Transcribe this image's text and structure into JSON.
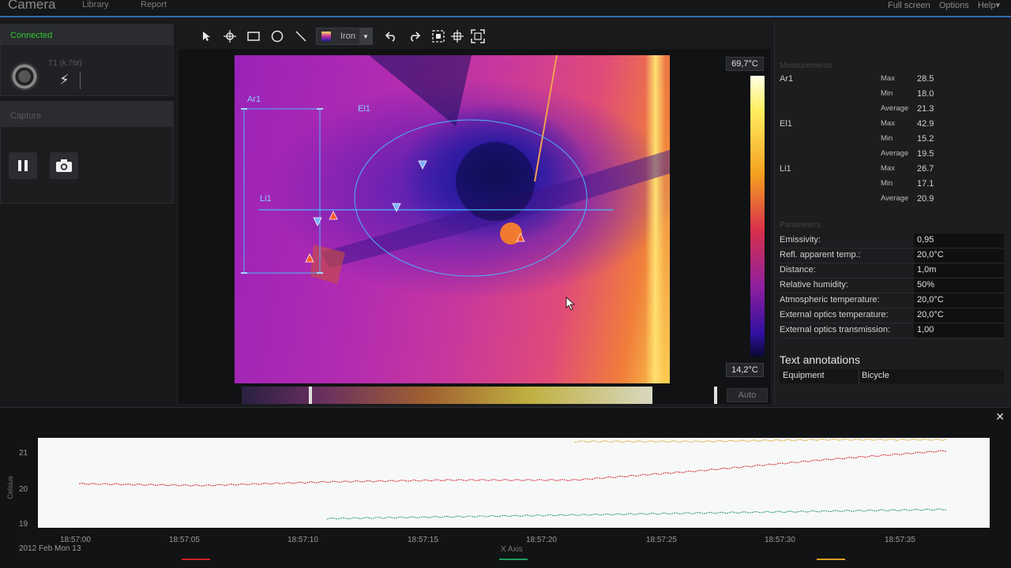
{
  "topbar": {
    "title": "Camera",
    "menu": [
      "Library",
      "Report"
    ],
    "right": [
      "Full screen",
      "Options",
      "Help▾"
    ]
  },
  "left": {
    "status": "Connected",
    "camera_name": "T1 (k.7bt)",
    "capture_header": "Capture"
  },
  "toolbar": {
    "palette": "Iron"
  },
  "image": {
    "temp_max": "69,7°C",
    "temp_min": "14,2°C",
    "auto_label": "Auto",
    "labels": {
      "ar1": "Ar1",
      "el1": "El1",
      "li1": "Li1"
    }
  },
  "measurements": {
    "header": "Measurements",
    "rows": [
      {
        "name": "Ar1",
        "stat": "Max",
        "value": "28.5"
      },
      {
        "name": "",
        "stat": "Min",
        "value": "18.0"
      },
      {
        "name": "",
        "stat": "Average",
        "value": "21.3"
      },
      {
        "name": "El1",
        "stat": "Max",
        "value": "42.9"
      },
      {
        "name": "",
        "stat": "Min",
        "value": "15.2"
      },
      {
        "name": "",
        "stat": "Average",
        "value": "19.5"
      },
      {
        "name": "Li1",
        "stat": "Max",
        "value": "26.7"
      },
      {
        "name": "",
        "stat": "Min",
        "value": "17.1"
      },
      {
        "name": "",
        "stat": "Average",
        "value": "20.9"
      }
    ]
  },
  "parameters": {
    "header": "Parameters",
    "rows": [
      {
        "label": "Emissivity:",
        "value": "0,95"
      },
      {
        "label": "Refl. apparent temp.:",
        "value": "20,0°C"
      },
      {
        "label": "Distance:",
        "value": "1,0m"
      },
      {
        "label": "Relative humidity:",
        "value": "50%"
      },
      {
        "label": "Atmospheric temperature:",
        "value": "20,0°C"
      },
      {
        "label": "External optics temperature:",
        "value": "20,0°C"
      },
      {
        "label": "External optics transmission:",
        "value": "1,00"
      }
    ]
  },
  "annotations": {
    "title": "Text annotations",
    "key": "Equipment",
    "value": "Bicycle"
  },
  "plot": {
    "ylabel": "Celsius",
    "yticks": [
      "21",
      "20",
      "19"
    ],
    "xticks": [
      "18:57:00",
      "18:57:05",
      "18:57:10",
      "18:57:15",
      "18:57:20",
      "18:57:25",
      "18:57:30",
      "18:57:35"
    ],
    "xlabel": "X Axis",
    "date": "2012 Feb Mon 13",
    "series_colors": [
      "#d0202a",
      "#1c9a5a",
      "#d8a020"
    ]
  },
  "chart_data": {
    "type": "line",
    "xlabel": "X Axis",
    "ylabel": "Celsius",
    "ylim": [
      18.85,
      21.3
    ],
    "x": [
      "18:57:00",
      "18:57:05",
      "18:57:10",
      "18:57:15",
      "18:57:20",
      "18:57:25",
      "18:57:30",
      "18:57:35"
    ],
    "series": [
      {
        "color": "#d0202a",
        "values": [
          20.05,
          20.0,
          20.1,
          20.15,
          20.15,
          20.4,
          20.7,
          20.95
        ]
      },
      {
        "color": "#1c9a5a",
        "values": [
          null,
          null,
          19.1,
          19.15,
          19.2,
          19.25,
          19.3,
          19.35
        ]
      },
      {
        "color": "#d8a020",
        "values": [
          null,
          null,
          null,
          null,
          21.2,
          21.2,
          21.25,
          21.25
        ]
      }
    ]
  }
}
